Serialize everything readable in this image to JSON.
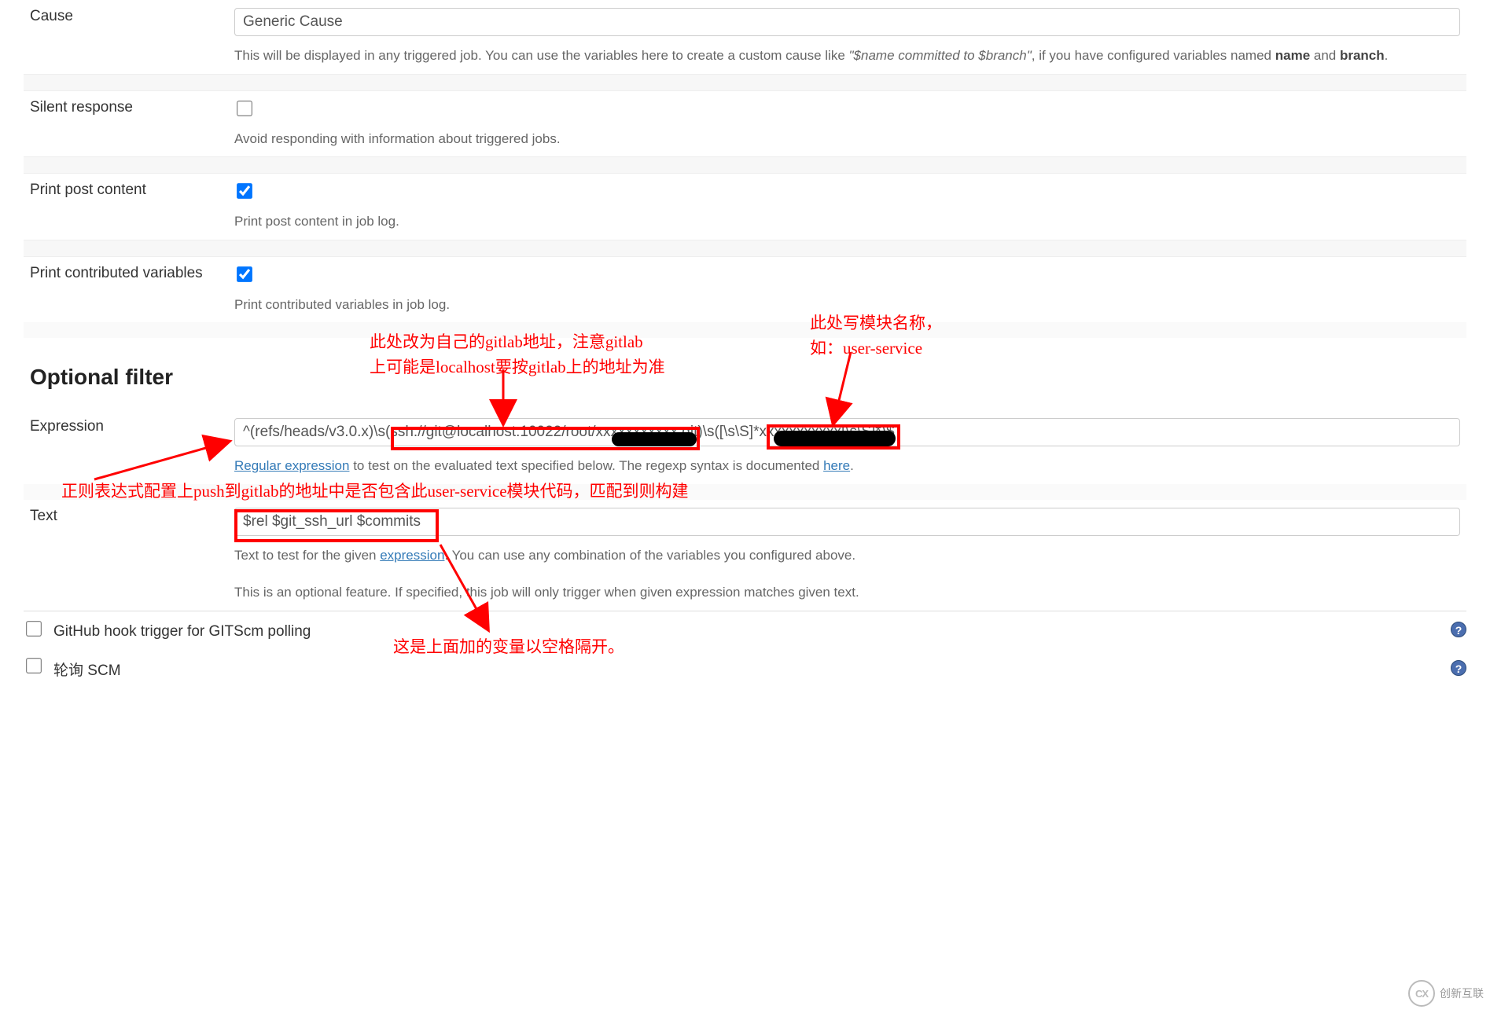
{
  "cause": {
    "label": "Cause",
    "value": "Generic Cause",
    "help_pre": "This will be displayed in any triggered job. You can use the variables here to create a custom cause like ",
    "help_em": "\"$name committed to $branch\"",
    "help_post": ", if you have configured variables named ",
    "help_b1": "name",
    "help_mid": " and ",
    "help_b2": "branch",
    "help_end": "."
  },
  "silent": {
    "label": "Silent response",
    "checked": false,
    "help": "Avoid responding with information about triggered jobs."
  },
  "print_post": {
    "label": "Print post content",
    "checked": true,
    "help": "Print post content in job log."
  },
  "print_vars": {
    "label": "Print contributed variables",
    "checked": true,
    "help": "Print contributed variables in job log."
  },
  "section": "Optional filter",
  "expression": {
    "label": "Expression",
    "value": "^(refs/heads/v3.0.x)\\s(ssh://git@localhost:10022/root/xxxxxxxxxxx.git)\\s([\\s\\S]*xxxxxxxxxxx[\\s\\S]*)$",
    "help_link1": "Regular expression",
    "help_mid": " to test on the evaluated text specified below. The regexp syntax is documented ",
    "help_link2": "here",
    "help_end": "."
  },
  "text": {
    "label": "Text",
    "value": "$rel $git_ssh_url $commits",
    "help_pre": "Text to test for the given ",
    "help_link": "expression",
    "help_post": ". You can use any combination of the variables you configured above.",
    "help2": "This is an optional feature. If specified, this job will only trigger when given expression matches given text."
  },
  "bottom": {
    "github": "GitHub hook trigger for GITScm polling",
    "scm": "轮询 SCM"
  },
  "annotations": {
    "regex_note": "正则表达式配置上push到gitlab的地址中是否包含此user-service模块代码，匹配到则构建",
    "gitlab_note1": "此处改为自己的gitlab地址，注意gitlab",
    "gitlab_note2": "上可能是localhost要按gitlab上的地址为准",
    "module_note1": "此处写模块名称，",
    "module_note2": "如：user-service",
    "vars_note": "这是上面加的变量以空格隔开。"
  },
  "logo": "创新互联"
}
